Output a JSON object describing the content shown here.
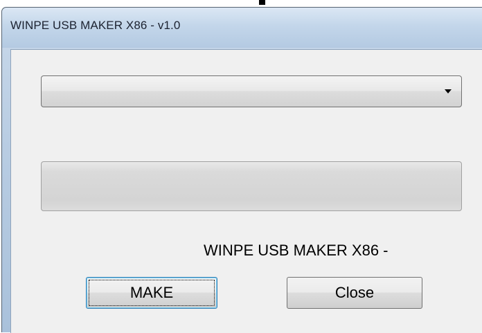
{
  "window": {
    "title": "WINPE USB MAKER X86 - v1.0"
  },
  "drive_select": {
    "selected_value": ""
  },
  "progress": {
    "value_percent": 0
  },
  "status": {
    "text": "WINPE USB MAKER X86 -"
  },
  "buttons": {
    "make_label": "MAKE",
    "close_label": "Close"
  },
  "colors": {
    "client_background": "#f0f0f0",
    "titlebar": "#c3d6ea",
    "focus_border": "#3c7fb1"
  }
}
